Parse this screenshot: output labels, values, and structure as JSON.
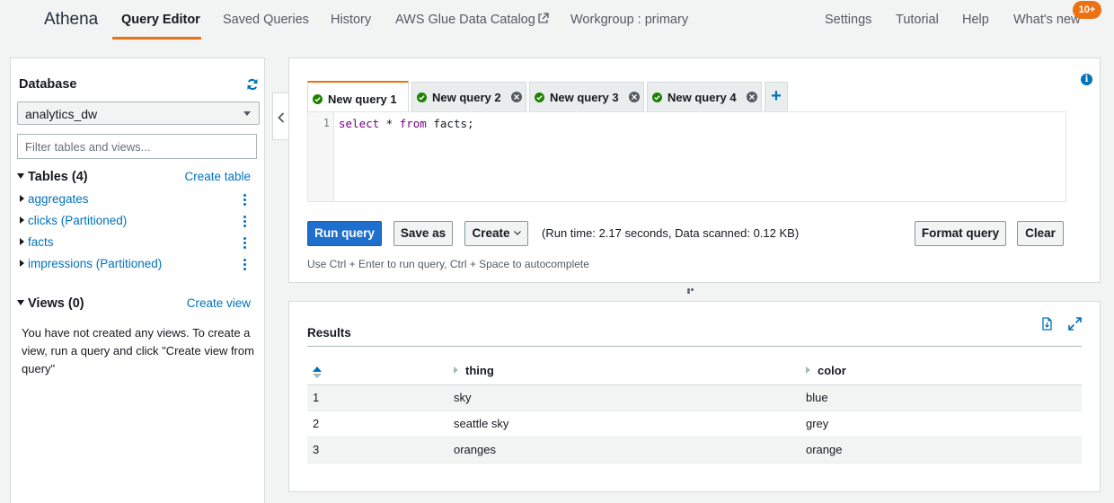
{
  "nav": {
    "brand": "Athena",
    "items": [
      "Query Editor",
      "Saved Queries",
      "History",
      "AWS Glue Data Catalog",
      "Workgroup : primary"
    ],
    "right_items": [
      "Settings",
      "Tutorial",
      "Help",
      "What's new"
    ],
    "badge": "10+",
    "accent_color": "#ec7211"
  },
  "sidebar": {
    "database_label": "Database",
    "database_value": "analytics_dw",
    "filter_placeholder": "Filter tables and views...",
    "tables_heading": "Tables (4)",
    "create_table": "Create table",
    "tables": [
      "aggregates",
      "clicks (Partitioned)",
      "facts",
      "impressions (Partitioned)"
    ],
    "views_heading": "Views (0)",
    "create_view": "Create view",
    "views_message": "You have not created any views. To create a view, run a query and click \"Create view from query\""
  },
  "editor": {
    "tabs": [
      "New query 1",
      "New query 2",
      "New query 3",
      "New query 4"
    ],
    "active_tab": "New query 1",
    "line_number": "1",
    "query": {
      "kw1": "select",
      "mid": " * ",
      "kw2": "from",
      "rest": " facts;"
    },
    "buttons": {
      "run": "Run query",
      "save_as": "Save as",
      "create": "Create",
      "format": "Format query",
      "clear": "Clear"
    },
    "run_info": "(Run time: 2.17 seconds, Data scanned: 0.12 KB)",
    "hint": "Use Ctrl + Enter to run query, Ctrl + Space to autocomplete"
  },
  "results": {
    "title": "Results",
    "columns": [
      "thing",
      "color"
    ],
    "rows": [
      [
        "1",
        "sky",
        "blue"
      ],
      [
        "2",
        "seattle sky",
        "grey"
      ],
      [
        "3",
        "oranges",
        "orange"
      ]
    ]
  }
}
